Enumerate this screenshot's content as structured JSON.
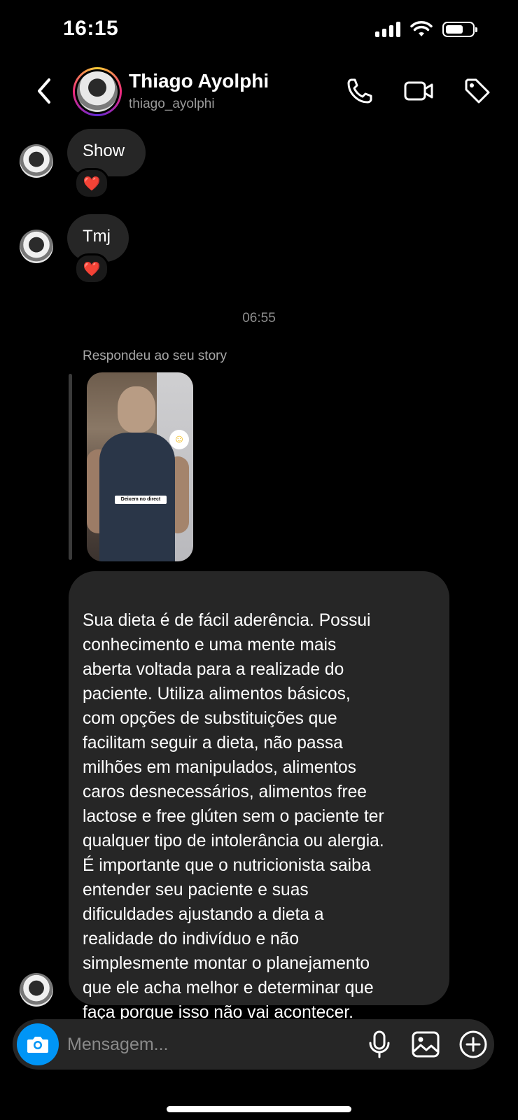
{
  "status_bar": {
    "time": "16:15",
    "signal_icon": "cellular-signal-icon",
    "wifi_icon": "wifi-icon",
    "battery_icon": "battery-icon",
    "battery_level": 0.6
  },
  "header": {
    "back_icon": "chevron-left-icon",
    "contact_name": "Thiago Ayolphi",
    "contact_username": "thiago_ayolphi",
    "actions": [
      "phone-icon",
      "video-camera-icon",
      "tag-icon"
    ]
  },
  "messages": [
    {
      "text": "Show",
      "reaction": "❤️"
    },
    {
      "text": "Tmj",
      "reaction": "❤️"
    }
  ],
  "timestamp": "06:55",
  "story_reply": {
    "label": "Respondeu ao seu story",
    "sticker_text": "Deixem no direct"
  },
  "long_message": "Sua dieta é de fácil aderência. Possui\nconhecimento e uma mente mais\naberta voltada para a realizade do\npaciente. Utiliza alimentos básicos,\ncom opções de substituições que\nfacilitam seguir a dieta, não passa\nmilhões em manipulados,  alimentos\ncaros desnecessários, alimentos free\nlactose e free glúten sem o paciente ter\nqualquer tipo de intolerância ou alergia.\nÉ importante que o nutricionista saiba\nentender seu paciente e suas\ndificuldades ajustando a dieta a\nrealidade do indivíduo e não\nsimplesmente montar o planejamento\nque ele acha melhor e determinar que\nfaça porque isso não vai acontecer.",
  "composer": {
    "placeholder": "Mensagem...",
    "camera_icon": "camera-icon",
    "icons": [
      "microphone-icon",
      "image-icon",
      "plus-circle-icon"
    ]
  },
  "colors": {
    "background": "#000000",
    "bubble": "#262626",
    "accent_blue": "#0095f6",
    "heart": "#ff3040"
  }
}
